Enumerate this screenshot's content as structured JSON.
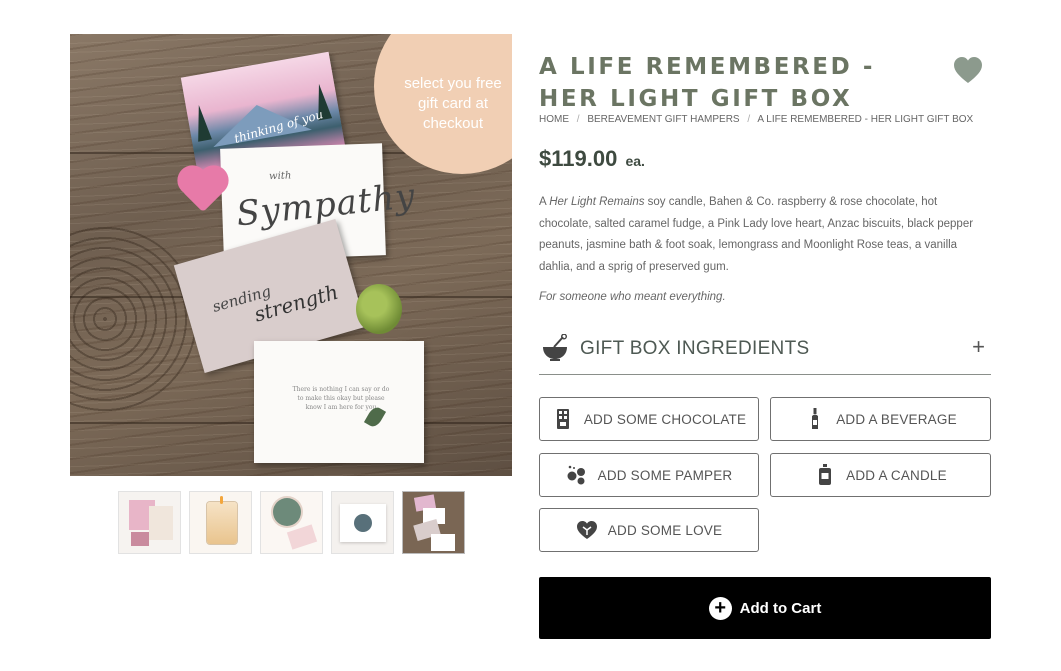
{
  "promo": {
    "text": "select you free gift card at checkout"
  },
  "hero_cards": {
    "thinking_of_you": "thinking of you",
    "with": "with",
    "sympathy": "Sympathy",
    "sending": "sending",
    "strength": "strength",
    "note": "There is nothing I can say or do to make this okay but please know I am here for you"
  },
  "product": {
    "title": "A LIFE REMEMBERED - HER LIGHT GIFT BOX",
    "price": "$119.00",
    "price_unit": "ea.",
    "description_prefix": "A ",
    "description_italic": "Her Light Remains",
    "description_rest": " soy candle, Bahen & Co. raspberry & rose chocolate, hot chocolate, salted caramel fudge, a Pink Lady love heart, Anzac biscuits, black pepper peanuts, jasmine bath & foot soak, lemongrass and Moonlight Rose teas, a vanilla dahlia, and a sprig of preserved gum.",
    "tagline": "For someone who meant everything."
  },
  "breadcrumb": {
    "home": "HOME",
    "category": "BEREAVEMENT GIFT HAMPERS",
    "current": "A LIFE REMEMBERED - HER LIGHT GIFT BOX",
    "separator": "/"
  },
  "wishlist": {
    "icon": "heart-icon",
    "color": "#8c9a8d"
  },
  "ingredients": {
    "label": "GIFT BOX INGREDIENTS",
    "toggle": "+",
    "icon": "mixing-bowl-icon"
  },
  "addons": {
    "chocolate": {
      "label": "ADD SOME CHOCOLATE",
      "icon": "chocolate-icon"
    },
    "beverage": {
      "label": "ADD A BEVERAGE",
      "icon": "bottle-icon"
    },
    "pamper": {
      "label": "ADD SOME PAMPER",
      "icon": "bath-bombs-icon"
    },
    "candle": {
      "label": "ADD A CANDLE",
      "icon": "candle-icon"
    },
    "love": {
      "label": "ADD SOME LOVE",
      "icon": "heart-icon"
    }
  },
  "cart": {
    "label": "Add to Cart",
    "icon": "plus-circle-icon",
    "plus": "+"
  },
  "colors": {
    "title": "#6b7563",
    "price": "#3e4a40",
    "promo": "#f1cfb4",
    "cart_bg": "#000000"
  }
}
